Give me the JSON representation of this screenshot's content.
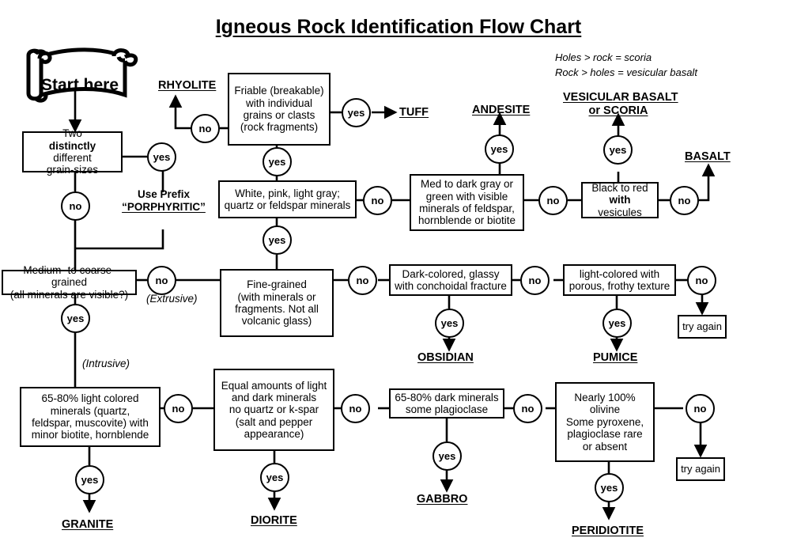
{
  "title": "Igneous Rock Identification Flow Chart",
  "start": {
    "label": "Start here",
    "icon": "scroll-banner-icon"
  },
  "legend": {
    "line1": "Holes > rock = scoria",
    "line2": "Rock > holes = vesicular basalt"
  },
  "notes": {
    "extrusive": "(Extrusive)",
    "intrusive": "(Intrusive)"
  },
  "prefix_note": {
    "line1": "Use Prefix",
    "line2": "“PORPHYRITIC”"
  },
  "decisions": {
    "grain_sizes": {
      "line1": "Two ",
      "bold": "distinctly",
      "line2": "different",
      "line3": "grain-sizes"
    },
    "friable": {
      "line1": "Friable (breakable)",
      "line2": "with individual",
      "line3": "grains or clasts",
      "line4": "(rock fragments)"
    },
    "felsic_color": {
      "line1": "White, pink, light gray;",
      "line2": "quartz or feldspar minerals"
    },
    "intermediate": {
      "line1": "Med to dark gray or",
      "line2": "green with visible",
      "line3": "minerals of feldspar,",
      "line4": "hornblende or biotite"
    },
    "vesicles": {
      "line1": "Black to red",
      "boldword": "with",
      "line2": " vesicules"
    },
    "coarse_grained": {
      "line1": "Medium- to coarse-grained",
      "line2": "(all minerals are visible?)"
    },
    "fine_grained": {
      "line1": "Fine-grained",
      "line2": "(with minerals or",
      "line3": "fragments. Not all",
      "line4": "volcanic glass)"
    },
    "glassy": {
      "line1": "Dark-colored, glassy",
      "line2": "with conchoidal fracture"
    },
    "frothy": {
      "line1": "light-colored with",
      "line2": "porous, frothy texture"
    },
    "felsic_intrusive": {
      "line1": "65-80% light colored",
      "line2": "minerals (quartz,",
      "line3": "feldspar, muscovite) with",
      "line4": "minor biotite, hornblende"
    },
    "intermediate_intrusive": {
      "line1": "Equal amounts of light",
      "line2": "and dark minerals",
      "line3": "no quartz or k-spar",
      "line4": "(salt and pepper",
      "line5": "appearance)"
    },
    "mafic_intrusive": {
      "line1": "65-80% dark minerals",
      "line2": "some plagioclase"
    },
    "ultramafic": {
      "line1": "Nearly 100%",
      "line2": "olivine",
      "line3": "Some pyroxene,",
      "line4": "plagioclase rare",
      "line5": "or absent"
    }
  },
  "try_again": {
    "label": "try again"
  },
  "answers": {
    "yes": "yes",
    "no": "no"
  },
  "results": {
    "rhyolite": "RHYOLITE",
    "tuff": "TUFF",
    "andesite": "ANDESITE",
    "vesicular_basalt_l1": "VESICULAR BASALT",
    "vesicular_basalt_l2": "or SCORIA",
    "basalt": "BASALT",
    "obsidian": "OBSIDIAN",
    "pumice": "PUMICE",
    "granite": "GRANITE",
    "diorite": "DIORITE",
    "gabbro": "GABBRO",
    "peridiotite": "PERIDIOTITE"
  },
  "colors": {
    "ink": "#000000",
    "paper": "#ffffff"
  }
}
